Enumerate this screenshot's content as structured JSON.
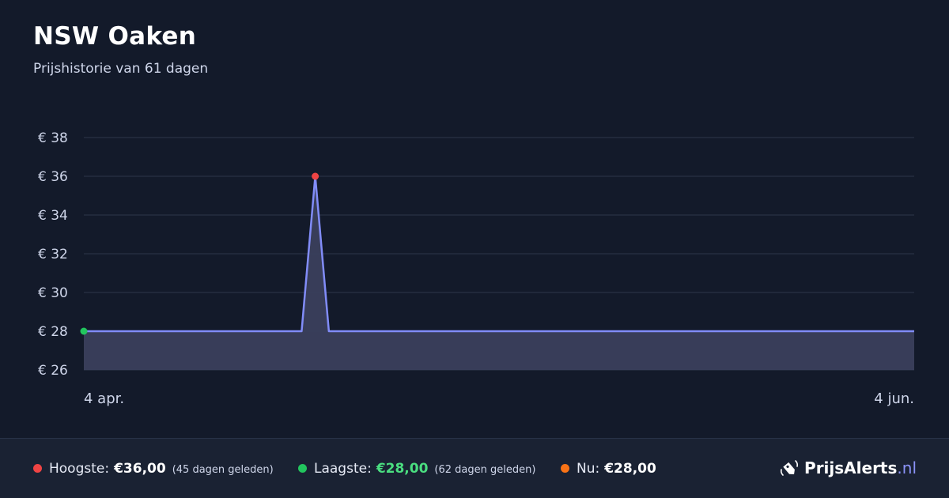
{
  "header": {
    "title": "NSW Oaken",
    "subtitle": "Prijshistorie van 61 dagen"
  },
  "chart_data": {
    "type": "area",
    "title": "",
    "xlabel": "",
    "ylabel": "",
    "y_tick_labels": [
      "€ 38",
      "€ 36",
      "€ 34",
      "€ 32",
      "€ 30",
      "€ 28",
      "€ 26"
    ],
    "y_ticks": [
      38,
      36,
      34,
      32,
      30,
      28,
      26
    ],
    "ylim": [
      26,
      38
    ],
    "x_tick_labels": [
      "4 apr.",
      "4 jun."
    ],
    "x_range_days": [
      0,
      61
    ],
    "grid": true,
    "series": [
      {
        "x": [
          0,
          16,
          17,
          18,
          61
        ],
        "y": [
          28,
          28,
          36,
          28,
          28
        ]
      }
    ],
    "markers": [
      {
        "x": 0,
        "y": 28,
        "color": "#22c55e"
      },
      {
        "x": 17,
        "y": 36,
        "color": "#ef4444"
      }
    ],
    "colors": {
      "line": "#818cf8",
      "fill": "#3a3f5c",
      "grid": "#252d40",
      "tick_text": "#cfd6ea"
    }
  },
  "footer": {
    "high": {
      "label": "Hoogste:",
      "value": "€36,00",
      "ago": "(45 dagen geleden)",
      "color": "#ef4444"
    },
    "low": {
      "label": "Laagste:",
      "value": "€28,00",
      "ago": "(62 dagen geleden)",
      "color": "#22c55e"
    },
    "now": {
      "label": "Nu:",
      "value": "€28,00",
      "color": "#f97316"
    },
    "brand": {
      "name": "PrijsAlerts",
      "tld": ".nl",
      "icon": "price-tag-icon"
    }
  }
}
